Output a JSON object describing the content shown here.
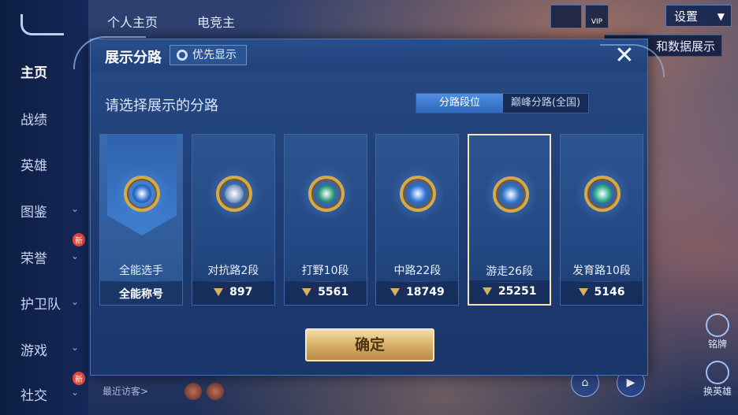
{
  "background": {
    "left_nav": [
      {
        "label": "主页",
        "active": true
      },
      {
        "label": "战绩",
        "active": false
      },
      {
        "label": "英雄",
        "active": false
      },
      {
        "label": "图鉴",
        "active": false,
        "chevron": true
      },
      {
        "label": "荣誉",
        "active": false,
        "chevron": true,
        "badge": "新"
      },
      {
        "label": "护卫队",
        "active": false,
        "chevron": true
      },
      {
        "label": "游戏",
        "active": false,
        "chevron": true
      },
      {
        "label": "社交",
        "active": false,
        "chevron": true,
        "badge": "新"
      }
    ],
    "top_tabs": [
      "个人主页",
      "电竞主"
    ],
    "vip_label": "VIP",
    "settings_label": "设置",
    "data_display_label": "和数据展示",
    "recent_visitors_label": "最近访客>",
    "right_labels": [
      "铭牌",
      "换英雄"
    ]
  },
  "modal": {
    "title": "展示分路",
    "priority_button": "优先显示",
    "close_symbol": "✕",
    "subtitle": "请选择展示的分路",
    "segmented": {
      "left": "分路段位",
      "right": "巅峰分路(全国)",
      "selected": "分路段位"
    },
    "cards": [
      {
        "name": "全能选手",
        "score": "全能称号",
        "score_has_icon": false,
        "selected": false,
        "banner": true,
        "core_color": "#2e6fd0"
      },
      {
        "name": "对抗路2段",
        "score": "897",
        "score_has_icon": true,
        "selected": false,
        "banner": false,
        "core_color": "#8fa8c8"
      },
      {
        "name": "打野10段",
        "score": "5561",
        "score_has_icon": true,
        "selected": false,
        "banner": false,
        "core_color": "#2a9a7a"
      },
      {
        "name": "中路22段",
        "score": "18749",
        "score_has_icon": true,
        "selected": false,
        "banner": false,
        "core_color": "#3a7ee0"
      },
      {
        "name": "游走26段",
        "score": "25251",
        "score_has_icon": true,
        "selected": true,
        "banner": false,
        "core_color": "#3f86d8"
      },
      {
        "name": "发育路10段",
        "score": "5146",
        "score_has_icon": true,
        "selected": false,
        "banner": false,
        "core_color": "#2fae8c"
      }
    ],
    "confirm_label": "确定"
  }
}
